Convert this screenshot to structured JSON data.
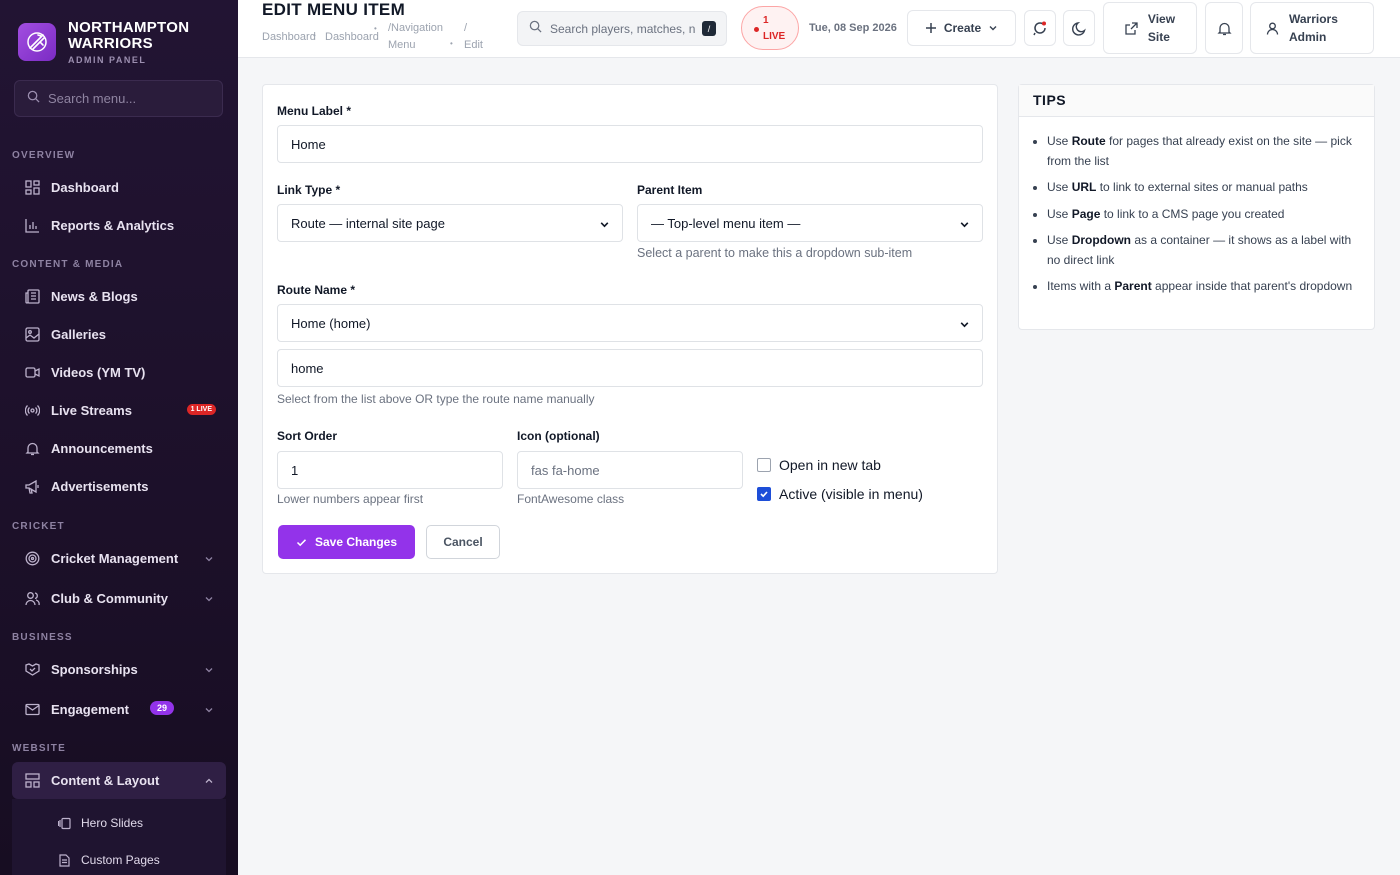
{
  "brand": {
    "title_line1": "NORTHAMPTON",
    "title_line2": "WARRIORS",
    "subtitle": "ADMIN PANEL"
  },
  "sidebar": {
    "search_placeholder": "Search menu...",
    "sections": {
      "overview": "OVERVIEW",
      "content_media": "CONTENT & MEDIA",
      "cricket": "CRICKET",
      "business": "BUSINESS",
      "website": "WEBSITE"
    },
    "items": {
      "dashboard": "Dashboard",
      "reports": "Reports & Analytics",
      "news": "News & Blogs",
      "galleries": "Galleries",
      "videos": "Videos (YM TV)",
      "live_streams": "Live Streams",
      "live_badge": "1 LIVE",
      "announcements": "Announcements",
      "advertisements": "Advertisements",
      "cricket_mgmt": "Cricket Management",
      "club_community": "Club & Community",
      "sponsorships": "Sponsorships",
      "engagement": "Engagement",
      "engagement_count": "29",
      "content_layout": "Content & Layout",
      "hero_slides": "Hero Slides",
      "custom_pages": "Custom Pages"
    }
  },
  "header": {
    "title": "EDIT MENU ITEM",
    "breadcrumb": {
      "c1": "Dashboard",
      "c2": "Dashboard",
      "c3_line1": "/Navigation",
      "c3_line2": "Menu",
      "c4_slash": "/",
      "c4": "Edit"
    },
    "search_placeholder": "Search players, matches, n",
    "search_key": "/",
    "live_count": "1",
    "live_label": "LIVE",
    "date": "Tue, 08 Sep 2026",
    "create_label": "Create",
    "view_site_line1": "View",
    "view_site_line2": "Site",
    "user_line1": "Warriors",
    "user_line2": "Admin"
  },
  "form": {
    "menu_label": {
      "label": "Menu Label *",
      "value": "Home"
    },
    "link_type": {
      "label": "Link Type *",
      "value": "Route — internal site page"
    },
    "parent_item": {
      "label": "Parent Item",
      "value": "— Top-level menu item —",
      "hint": "Select a parent to make this a dropdown sub-item"
    },
    "route_name": {
      "label": "Route Name *",
      "select_value": "Home (home)",
      "input_value": "home",
      "hint": "Select from the list above OR type the route name manually"
    },
    "sort_order": {
      "label": "Sort Order",
      "value": "1",
      "hint": "Lower numbers appear first"
    },
    "icon": {
      "label": "Icon (optional)",
      "placeholder": "fas fa-home",
      "hint": "FontAwesome class"
    },
    "open_new_tab": {
      "label": "Open in new tab",
      "checked": false
    },
    "active": {
      "label": "Active (visible in menu)",
      "checked": true
    },
    "save_label": "Save Changes",
    "cancel_label": "Cancel"
  },
  "tips": {
    "title": "TIPS",
    "items": [
      {
        "pre": "Use ",
        "bold": "Route",
        "post": " for pages that already exist on the site — pick from the list"
      },
      {
        "pre": "Use ",
        "bold": "URL",
        "post": " to link to external sites or manual paths"
      },
      {
        "pre": "Use ",
        "bold": "Page",
        "post": " to link to a CMS page you created"
      },
      {
        "pre": "Use ",
        "bold": "Dropdown",
        "post": " as a container — it shows as a label with no direct link"
      },
      {
        "pre": "Items with a ",
        "bold": "Parent",
        "post": " appear inside that parent's dropdown"
      }
    ]
  },
  "colors": {
    "accent": "#9333ea",
    "sidebar_bg": "#1c1029",
    "live_red": "#dc2626"
  }
}
